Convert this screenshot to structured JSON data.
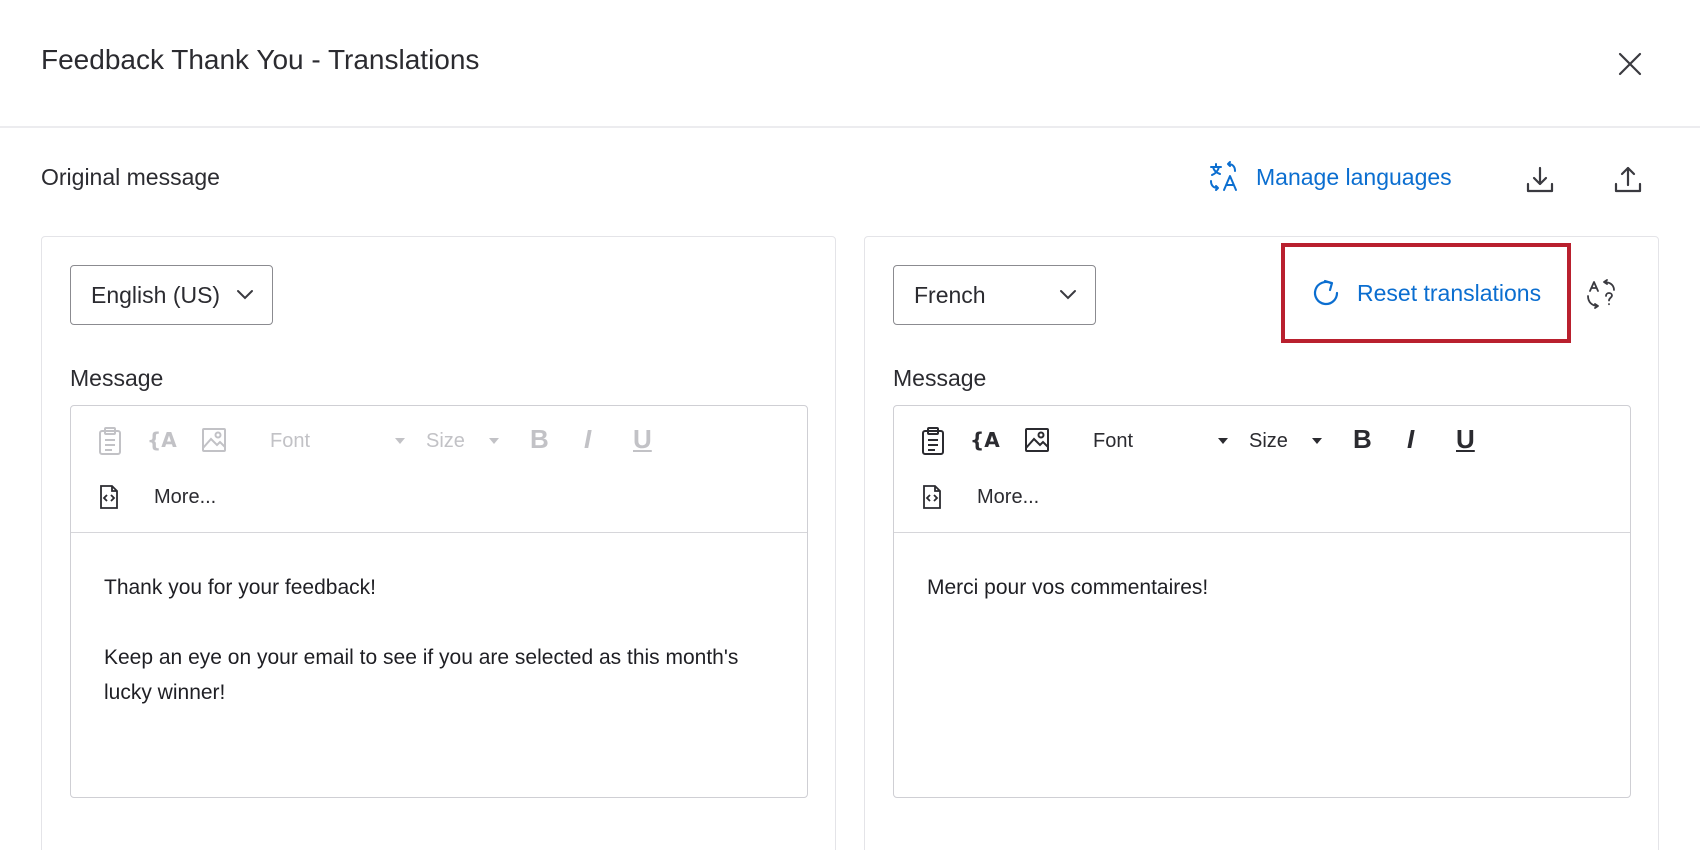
{
  "dialog": {
    "title": "Feedback Thank You - Translations"
  },
  "subheader": {
    "title": "Original message",
    "manage_languages_label": "Manage languages"
  },
  "left_panel": {
    "language": "English (US)",
    "message_label": "Message",
    "toolbar": {
      "font_label": "Font",
      "size_label": "Size",
      "bold": "B",
      "italic": "I",
      "underline": "U",
      "more_label": "More..."
    },
    "body": {
      "line1": "Thank you for your feedback!",
      "line2": "Keep an eye on your email to see if you are selected as this month's lucky winner!"
    }
  },
  "right_panel": {
    "language": "French",
    "reset_label": "Reset translations",
    "message_label": "Message",
    "toolbar": {
      "font_label": "Font",
      "size_label": "Size",
      "bold": "B",
      "italic": "I",
      "underline": "U",
      "more_label": "More..."
    },
    "body": {
      "line1": "Merci pour vos commentaires!"
    }
  },
  "colors": {
    "accent_blue": "#0b6ed0",
    "highlight_red": "#b9202e",
    "disabled_gray": "#c2c2c6"
  },
  "icons": [
    "close-icon",
    "translate-icon",
    "download-icon",
    "upload-icon",
    "refresh-icon",
    "auto-translate-icon",
    "chevron-down-icon",
    "paste-icon",
    "piped-text-icon",
    "image-icon",
    "source-code-icon"
  ]
}
